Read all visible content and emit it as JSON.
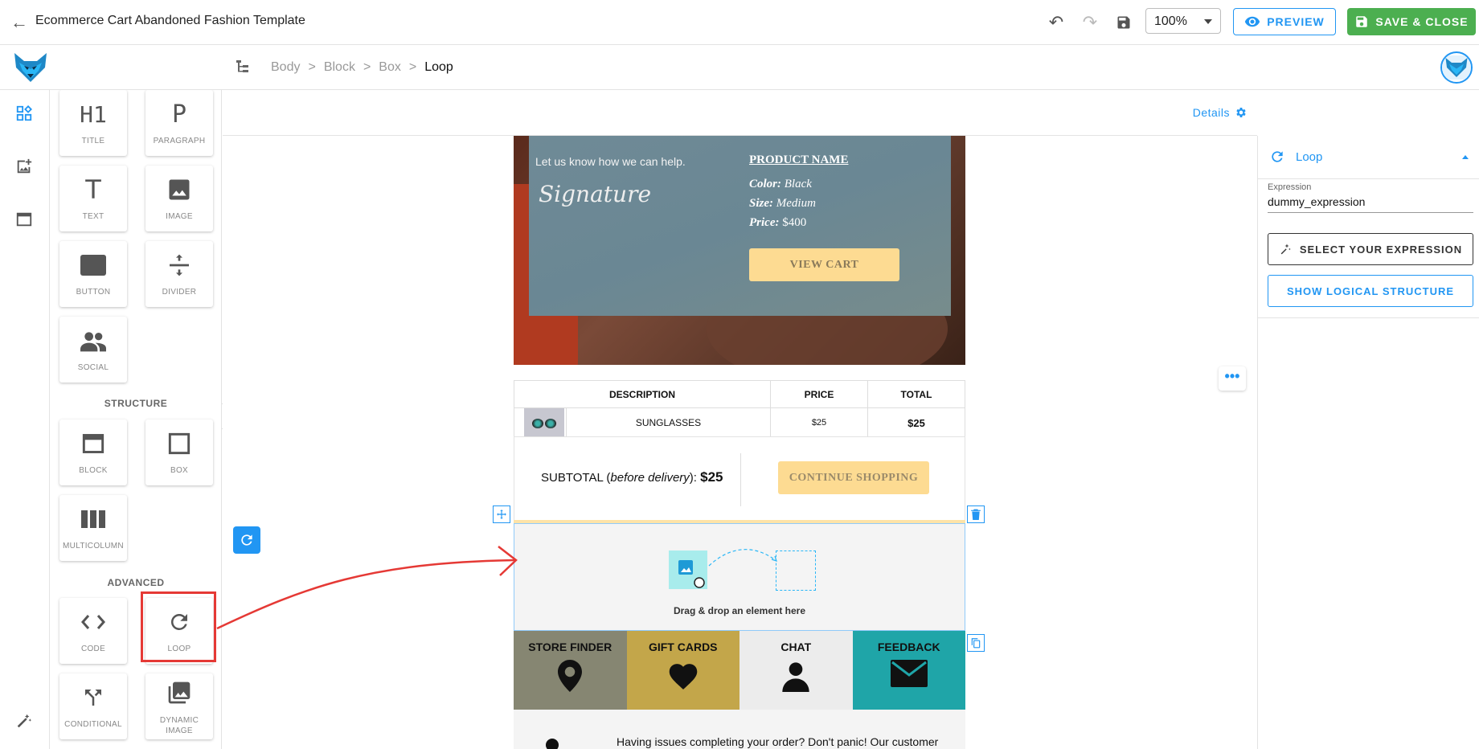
{
  "header": {
    "title": "Ecommerce Cart Abandoned Fashion Template",
    "zoom_value": "100%",
    "preview_label": "PREVIEW",
    "save_label": "SAVE & CLOSE"
  },
  "breadcrumb": {
    "items": [
      "Body",
      "Block",
      "Box"
    ],
    "separator": ">",
    "current": "Loop"
  },
  "palette": {
    "basic": [
      {
        "label": "TITLE",
        "icon": "h1-icon"
      },
      {
        "label": "PARAGRAPH",
        "icon": "paragraph-icon"
      },
      {
        "label": "TEXT",
        "icon": "text-icon"
      },
      {
        "label": "IMAGE",
        "icon": "image-icon"
      },
      {
        "label": "BUTTON",
        "icon": "button-icon"
      },
      {
        "label": "DIVIDER",
        "icon": "divider-icon"
      },
      {
        "label": "SOCIAL",
        "icon": "social-icon"
      }
    ],
    "structure_title": "STRUCTURE",
    "structure": [
      {
        "label": "BLOCK",
        "icon": "block-icon"
      },
      {
        "label": "BOX",
        "icon": "box-icon"
      },
      {
        "label": "MULTICOLUMN",
        "icon": "multicolumn-icon"
      }
    ],
    "advanced_title": "ADVANCED",
    "advanced": [
      {
        "label": "CODE",
        "icon": "code-icon"
      },
      {
        "label": "LOOP",
        "icon": "loop-icon"
      },
      {
        "label": "CONDITIONAL",
        "icon": "conditional-icon"
      },
      {
        "label": "DYNAMIC",
        "label2": "IMAGE",
        "icon": "dynamic-image-icon"
      }
    ],
    "h1_glyph": "H1",
    "p_glyph": "P",
    "t_glyph": "T"
  },
  "canvas": {
    "details_label": "Details"
  },
  "email": {
    "help_text": "Let us know how we can help.",
    "signature": "Signature",
    "product_name": "PRODUCT NAME",
    "color_label": "Color:",
    "color_value": "Black",
    "size_label": "Size:",
    "size_value": "Medium",
    "price_label": "Price:",
    "price_value": "$400",
    "view_cart": "VIEW CART",
    "table": {
      "headers": [
        "DESCRIPTION",
        "PRICE",
        "TOTAL"
      ],
      "row": {
        "description": "SUNGLASSES",
        "price": "$25",
        "total": "$25"
      }
    },
    "subtotal_prefix": "SUBTOTAL (",
    "subtotal_italic": "before delivery",
    "subtotal_suffix": "):",
    "subtotal_value": "$25",
    "continue_shopping": "CONTINUE SHOPPING",
    "dropzone_text": "Drag & drop an element here",
    "footer": [
      {
        "label": "STORE FINDER",
        "bg": "#868672",
        "icon": "map-pin-icon"
      },
      {
        "label": "GIFT CARDS",
        "bg": "#c3a64a",
        "icon": "heart-icon"
      },
      {
        "label": "CHAT",
        "bg": "#ececec",
        "icon": "person-icon"
      },
      {
        "label": "FEEDBACK",
        "bg": "#1fa5a8",
        "icon": "envelope-icon"
      }
    ],
    "issue_text": "Having issues completing your order? Don't panic! Our customer"
  },
  "right_panel": {
    "section_title": "Loop",
    "expression_label": "Expression",
    "expression_value": "dummy_expression",
    "select_button": "SELECT YOUR EXPRESSION",
    "structure_button": "SHOW LOGICAL STRUCTURE"
  },
  "colors": {
    "accent": "#2196f3",
    "save": "#4caf50",
    "highlight": "#e53935",
    "button_yellow": "#fddb92"
  }
}
